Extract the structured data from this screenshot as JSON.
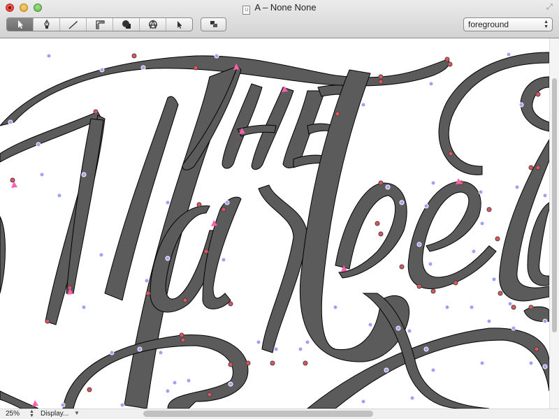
{
  "window": {
    "title": "A – None None",
    "doc_icon": "U"
  },
  "toolbar": {
    "tools": [
      {
        "name": "select-tool",
        "icon": "arrow-pointer-icon",
        "active": true
      },
      {
        "name": "pen-tool",
        "icon": "pen-nib-icon",
        "active": false
      },
      {
        "name": "knife-tool",
        "icon": "knife-icon",
        "active": false
      },
      {
        "name": "measure-tool",
        "icon": "ruler-icon",
        "active": false
      },
      {
        "name": "shape-tool",
        "icon": "shapes-icon",
        "active": false
      },
      {
        "name": "anchor-tool",
        "icon": "compass-icon",
        "active": false
      },
      {
        "name": "pointer-tool",
        "icon": "small-arrow-icon",
        "active": false
      }
    ],
    "layer_button_icon": "layers-icon",
    "layer_select": {
      "value": "foreground"
    }
  },
  "canvas": {
    "glyph_text": "The Market",
    "fill_color": "#5b5b5b",
    "on_curve_color": "#e8515f",
    "off_curve_color": "#9ea2f4",
    "start_marker_color": "#ff5fb0"
  },
  "statusbar": {
    "zoom": "25%",
    "display_label": "Display..."
  }
}
